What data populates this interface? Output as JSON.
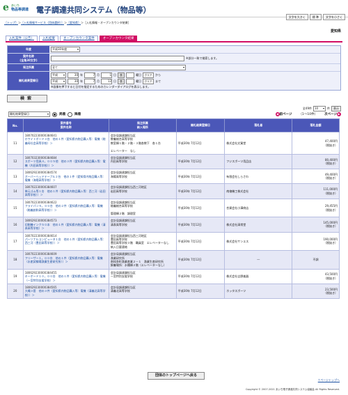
{
  "app": {
    "logo_mark": "e",
    "logo_line1": "あいち",
    "logo_line2": "物品等調達",
    "title": "電子調達共同システム（物品等）"
  },
  "top_buttons": [
    "文字を大きく",
    "標 準",
    "文字を小さく"
  ],
  "breadcrumb": [
    {
      "label": "［トップ］",
      "link": true
    },
    {
      "label": "＞",
      "link": false
    },
    {
      "label": "［入札情報サービス（団体選択）］",
      "link": true
    },
    {
      "label": "＞",
      "link": false
    },
    {
      "label": "［愛知県］",
      "link": true
    },
    {
      "label": "＞［入札情報・オープンカウンタ結果］",
      "link": false
    }
  ],
  "region": "愛知県",
  "tabs": [
    {
      "label": "入札案件（公告）",
      "active": false
    },
    {
      "label": "入札結果",
      "active": false
    },
    {
      "label": "オープンカウンタ案件",
      "active": false
    },
    {
      "label": "オープンカウンタ結果",
      "active": true
    }
  ],
  "form": {
    "year_label": "年度",
    "year_value": "平成30年度",
    "name_label": "案件名称",
    "name_sub": "(全角30文字)",
    "name_hint": "※部分一致で検索します。",
    "org_label": "発注所属",
    "org_value": "全て",
    "date_label": "開札結果登録日",
    "from": {
      "era": "平成",
      "y": "30",
      "m": "7",
      "d": "1",
      "cal": "表",
      "weekday": "曜日",
      "clear": "クリア",
      "suffix": "から"
    },
    "to": {
      "era": "平成",
      "y": "30",
      "m": "7",
      "d": "12",
      "cal": "表",
      "weekday": "曜日",
      "clear": "クリア",
      "suffix": "まで"
    },
    "date_note": "※画像を押下すると日付を指定するためのカレンダーダイアログを表示します。",
    "search_button": "検索"
  },
  "order": {
    "select": "開札結果登録日",
    "asc": "昇順",
    "desc": "降順",
    "asc_selected": true
  },
  "count": {
    "text": "全49件",
    "page_label": "10",
    "per_page": "件",
    "display": "表示"
  },
  "pager": {
    "prev": "前ページ",
    "range": "（1～10件）",
    "next": "次ページ"
  },
  "table": {
    "headers": [
      "No.",
      "案件番号\n案件名称",
      "発注所属\n納入場所",
      "開札結果登録日",
      "落札者",
      "落札金額"
    ],
    "rows": [
      {
        "no": "11",
        "code": "180702230000384641",
        "name": "ホワイトボード３台　他の１件（愛知県内物品購入等：電機（総義母社会高等学校）＞",
        "org": "会計局調達課担当区\n教養総合高等学校",
        "place": "教室棟１階・２階・３階各教下　各１台\n\n エレベーター　なし",
        "date": "平成30年 7月12日",
        "winner": "株式会社文賀堂",
        "amount": "47,400円",
        "tax": "（税抜き）"
      },
      {
        "no": "12",
        "code": "180703230000384684",
        "name": "スポーツ用具４，００５他　他の３件（愛知県内物品購入等：電機（内田高等学校））＞",
        "org": "会計局調達課担当区\n内田高等学校",
        "place": "",
        "date": "平成30年 7月12日",
        "winner": "フジスポーツ用品店",
        "amount": "80,400円",
        "tax": "（税抜き）"
      },
      {
        "no": "13",
        "code": "180629230000384574",
        "name": "オーバーヘッドテーブル２台　他の１件（愛知県内物品購入等：電機（海陽高等学校）＞",
        "org": "会計局調達課担当区\n海陽高等学校",
        "place": "",
        "date": "平成30年 7月12日",
        "winner": "有限会社しらさわ",
        "amount": "49,400円",
        "tax": "（税抜き）"
      },
      {
        "no": "14",
        "code": "180702230000384607",
        "name": "単元ゴム等１台　他の１件（愛知県内物品購入等：西三河（岩田高等学校））＞",
        "org": "会計局調達課担当西三河地区\n岩田高等学校",
        "place": "",
        "date": "平成30年 7月12日",
        "winner": "南億機工株式会社",
        "amount": "111,000円",
        "tax": "（税抜き）"
      },
      {
        "no": "15",
        "code": "180702230000384622",
        "name": "フライパン５，００台　他の２件（愛知県内物品購入等：電機（総義創和高等学校））＞",
        "org": "会計局調達課担当区\n総義総合高等学校",
        "place": "\n 管理棟２階　調理室",
        "date": "平成30年 7月12日",
        "winner": "合資会社小澤商店",
        "amount": "29,455円",
        "tax": "（税抜き）"
      },
      {
        "no": "16",
        "code": "180629230000384573",
        "name": "印刷機インク５０本　他の１件（愛知県内物品購入等：電機（清表高等学校）＞",
        "org": "会計局調達課担当区\n清表高等学校",
        "place": "",
        "date": "平成30年 7月12日",
        "winner": "株式会社清常堂",
        "amount": "145,000円",
        "tax": "（税抜き）"
      },
      {
        "no": "17",
        "code": "180702230000384614",
        "name": "パーソナルコンピュータ１台　他の１件（愛知県内物品購入等：西三河（豊田高等学校））＞",
        "org": "会計局調達課担当西三河地区\n豊田高等学校",
        "place": "豊田高等学校３階　職員室　エレベーターなし\n納入日要連絡",
        "date": "平成30年 7月12日",
        "winner": "株式会社サンエス",
        "amount": "190,000円",
        "tax": "（税抜き）"
      },
      {
        "no": "18",
        "code": "180702230000384609",
        "name": "フリーザー１，００台　他の１件（愛知県内物品購入等：電機（水産試験場漁業生産研究所））＞",
        "org": "会計局調達課担当区\n漁業研究所",
        "place": "南知多町漁業産業２－１　漁業生産研究所\n飼養場所：水槽棟２階（エレベーターなし）",
        "date": "平成30年 7月12日",
        "winner": "―",
        "amount": "不調",
        "tax": ""
      },
      {
        "no": "19",
        "code": "180629230000384455",
        "name": "キーボード１０，００台　他の１件（愛知県内物品購入等：電機（一宮特別支援学校）＞",
        "org": "会計局調達課担当区\n一宮特別支援学校",
        "place": "",
        "date": "平成30年 7月12日",
        "winner": "株式会社吉野楽器",
        "amount": "43,500円",
        "tax": "（税抜き）"
      },
      {
        "no": "20",
        "code": "180629230000384565",
        "name": "大縄３套　他の３件（愛知県内物品購入等：電機（清義北高等学校））＞",
        "org": "会計局調達課担当区\n清義北高等学校",
        "place": "",
        "date": "平成30年 7月12日",
        "winner": "ホッタスポーツ",
        "amount": "23,500円",
        "tax": "（税抜き）"
      }
    ]
  },
  "bottom_button": "団体のトップページへ戻る",
  "page_top": "↑ページトップへ",
  "copyright": "Copyright © 2007-2021 あいち電子調達共同システム協議会 All Rights Reserved."
}
